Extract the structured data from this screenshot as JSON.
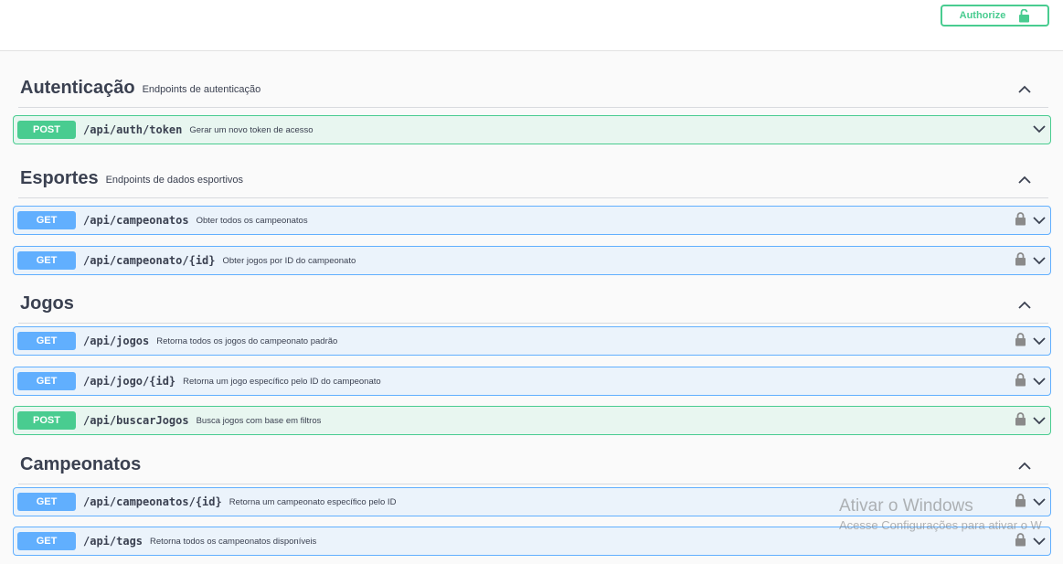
{
  "header": {
    "authorize_label": "Authorize"
  },
  "sections": [
    {
      "title": "Autenticação",
      "description": "Endpoints de autenticação",
      "ops": [
        {
          "method": "POST",
          "path": "/api/auth/token",
          "summary": "Gerar um novo token de acesso",
          "locked": false
        }
      ]
    },
    {
      "title": "Esportes",
      "description": "Endpoints de dados esportivos",
      "ops": [
        {
          "method": "GET",
          "path": "/api/campeonatos",
          "summary": "Obter todos os campeonatos",
          "locked": true
        },
        {
          "method": "GET",
          "path": "/api/campeonato/{id}",
          "summary": "Obter jogos por ID do campeonato",
          "locked": true
        }
      ]
    },
    {
      "title": "Jogos",
      "description": "",
      "ops": [
        {
          "method": "GET",
          "path": "/api/jogos",
          "summary": "Retorna todos os jogos do campeonato padrão",
          "locked": true
        },
        {
          "method": "GET",
          "path": "/api/jogo/{id}",
          "summary": "Retorna um jogo específico pelo ID do campeonato",
          "locked": true
        },
        {
          "method": "POST",
          "path": "/api/buscarJogos",
          "summary": "Busca jogos com base em filtros",
          "locked": true
        }
      ]
    },
    {
      "title": "Campeonatos",
      "description": "",
      "ops": [
        {
          "method": "GET",
          "path": "/api/campeonatos/{id}",
          "summary": "Retorna um campeonato específico pelo ID",
          "locked": true
        },
        {
          "method": "GET",
          "path": "/api/tags",
          "summary": "Retorna todos os campeonatos disponíveis",
          "locked": true
        }
      ]
    }
  ],
  "watermark": {
    "line1": "Ativar o Windows",
    "line2": "Acesse Configurações para ativar o W"
  },
  "colors": {
    "get": "#61affe",
    "post": "#49cc90",
    "text": "#3b4151"
  },
  "icons": {
    "authorize": "unlocked-icon",
    "operation_lock": "lock-icon",
    "expand": "chevron-down-icon",
    "collapse": "chevron-up-icon"
  }
}
